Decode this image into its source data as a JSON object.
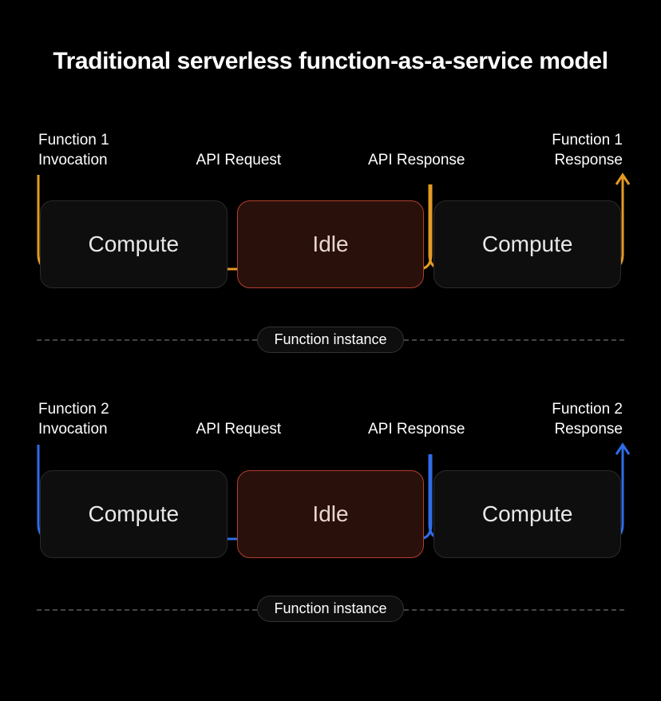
{
  "title": "Traditional serverless function-as-a-service model",
  "colors": {
    "orange": "#e39a25",
    "blue": "#2f6ce8",
    "idle_fill": "#2a100b",
    "idle_border": "#b13f2e"
  },
  "functions": [
    {
      "id": "fn1",
      "accent": "orange",
      "labels": {
        "invocation": "Function 1\nInvocation",
        "api_request": "API Request",
        "api_response": "API Response",
        "response": "Function 1\nResponse"
      },
      "cells": [
        "Compute",
        "Idle",
        "Compute"
      ],
      "separator_label": "Function instance"
    },
    {
      "id": "fn2",
      "accent": "blue",
      "labels": {
        "invocation": "Function 2\nInvocation",
        "api_request": "API Request",
        "api_response": "API Response",
        "response": "Function 2\nResponse"
      },
      "cells": [
        "Compute",
        "Idle",
        "Compute"
      ],
      "separator_label": "Function instance"
    }
  ]
}
